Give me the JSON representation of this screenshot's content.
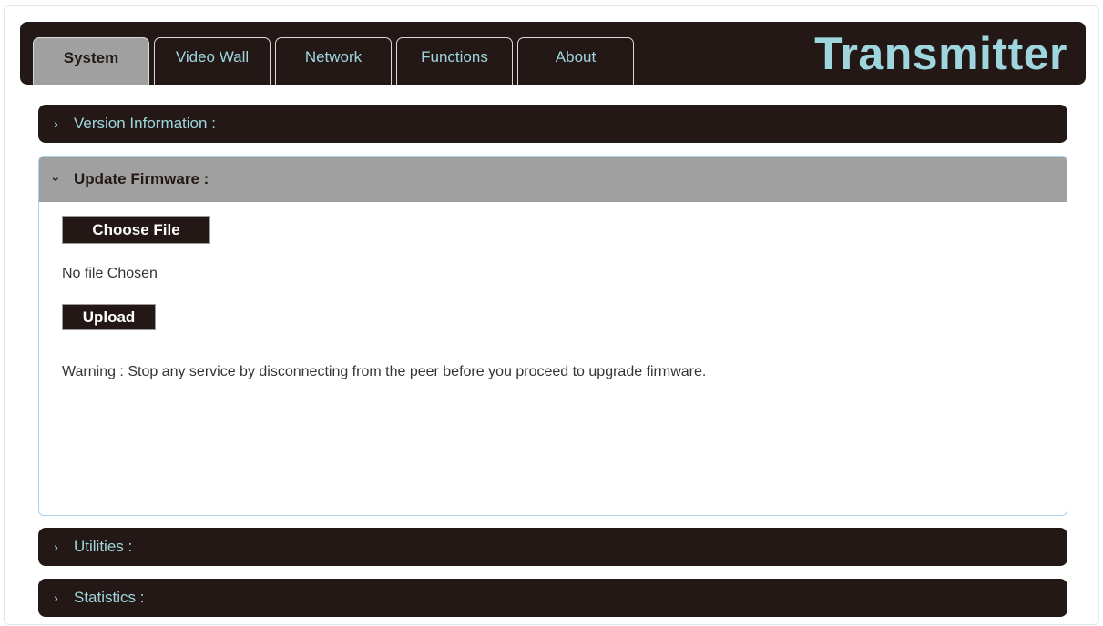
{
  "header": {
    "brand": "Transmitter",
    "tabs": [
      {
        "label": "System",
        "active": true
      },
      {
        "label": "Video Wall",
        "active": false
      },
      {
        "label": "Network",
        "active": false
      },
      {
        "label": "Functions",
        "active": false
      },
      {
        "label": "About",
        "active": false
      }
    ]
  },
  "panels": {
    "version": {
      "label": "Version Information :",
      "expanded": false
    },
    "firmware": {
      "label": "Update Firmware :",
      "expanded": true,
      "choose_file_label": "Choose File",
      "file_status": "No file Chosen",
      "upload_label": "Upload",
      "warning": "Warning : Stop any service by disconnecting from the peer before you proceed to upgrade firmware."
    },
    "utilities": {
      "label": "Utilities :",
      "expanded": false
    },
    "statistics": {
      "label": "Statistics :",
      "expanded": false
    }
  },
  "colors": {
    "dark": "#231815",
    "accent": "#9fd6de",
    "active_tab": "#a0a0a0",
    "panel_border": "#a9d3ec"
  },
  "icons": {
    "collapsed": "chevron-right-icon",
    "expanded": "chevron-down-icon"
  }
}
